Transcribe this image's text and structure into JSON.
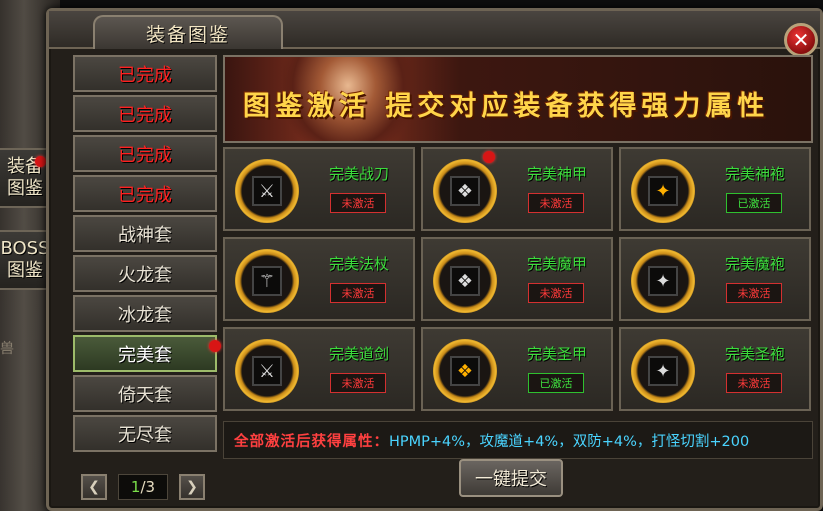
{
  "window": {
    "title": "装备图鉴",
    "close_symbol": "✕"
  },
  "side_tabs": [
    {
      "label": "装备\n图鉴",
      "has_dot": true
    },
    {
      "label": "BOSS\n图鉴",
      "has_dot": false
    }
  ],
  "side_fragment": "兽",
  "sets": [
    {
      "label": "已完成",
      "state": "done"
    },
    {
      "label": "已完成",
      "state": "done"
    },
    {
      "label": "已完成",
      "state": "done"
    },
    {
      "label": "已完成",
      "state": "done"
    },
    {
      "label": "战神套",
      "state": "normal"
    },
    {
      "label": "火龙套",
      "state": "normal"
    },
    {
      "label": "冰龙套",
      "state": "normal"
    },
    {
      "label": "完美套",
      "state": "active"
    },
    {
      "label": "倚天套",
      "state": "normal"
    },
    {
      "label": "无尽套",
      "state": "normal"
    }
  ],
  "pager": {
    "prev_icon": "chevron-left-icon",
    "next_icon": "chevron-right-icon",
    "current": "1",
    "total": "/3"
  },
  "banner": {
    "text": "图鉴激活 提交对应装备获得强力属性"
  },
  "items": [
    {
      "name": "完美战刀",
      "status": "未激活",
      "active": false,
      "icon": "blade-icon",
      "tone": "silver",
      "dot": false
    },
    {
      "name": "完美神甲",
      "status": "未激活",
      "active": false,
      "icon": "armor-icon",
      "tone": "silver",
      "dot": true
    },
    {
      "name": "完美神袍",
      "status": "已激活",
      "active": true,
      "icon": "robe-icon",
      "tone": "gold",
      "dot": false
    },
    {
      "name": "完美法杖",
      "status": "未激活",
      "active": false,
      "icon": "staff-icon",
      "tone": "silver",
      "dot": false
    },
    {
      "name": "完美魔甲",
      "status": "未激活",
      "active": false,
      "icon": "armor-icon",
      "tone": "silver",
      "dot": false
    },
    {
      "name": "完美魔袍",
      "status": "未激活",
      "active": false,
      "icon": "robe-icon",
      "tone": "silver",
      "dot": false
    },
    {
      "name": "完美道剑",
      "status": "未激活",
      "active": false,
      "icon": "sword-icon",
      "tone": "silver",
      "dot": false
    },
    {
      "name": "完美圣甲",
      "status": "已激活",
      "active": true,
      "icon": "armor-icon",
      "tone": "gold",
      "dot": false
    },
    {
      "name": "完美圣袍",
      "status": "未激活",
      "active": false,
      "icon": "robe-icon",
      "tone": "silver",
      "dot": false
    }
  ],
  "bonus": {
    "label": "全部激活后获得属性：",
    "value": "HPMP+4%，攻魔道+4%，双防+4%，打怪切割+200"
  },
  "submit_label": "一键提交",
  "colors": {
    "done_text": "#ff2020",
    "item_name": "#3cdc3c",
    "bonus_label": "#ff4040",
    "bonus_value": "#4ad4ff",
    "banner_text": "#ffd54a"
  }
}
